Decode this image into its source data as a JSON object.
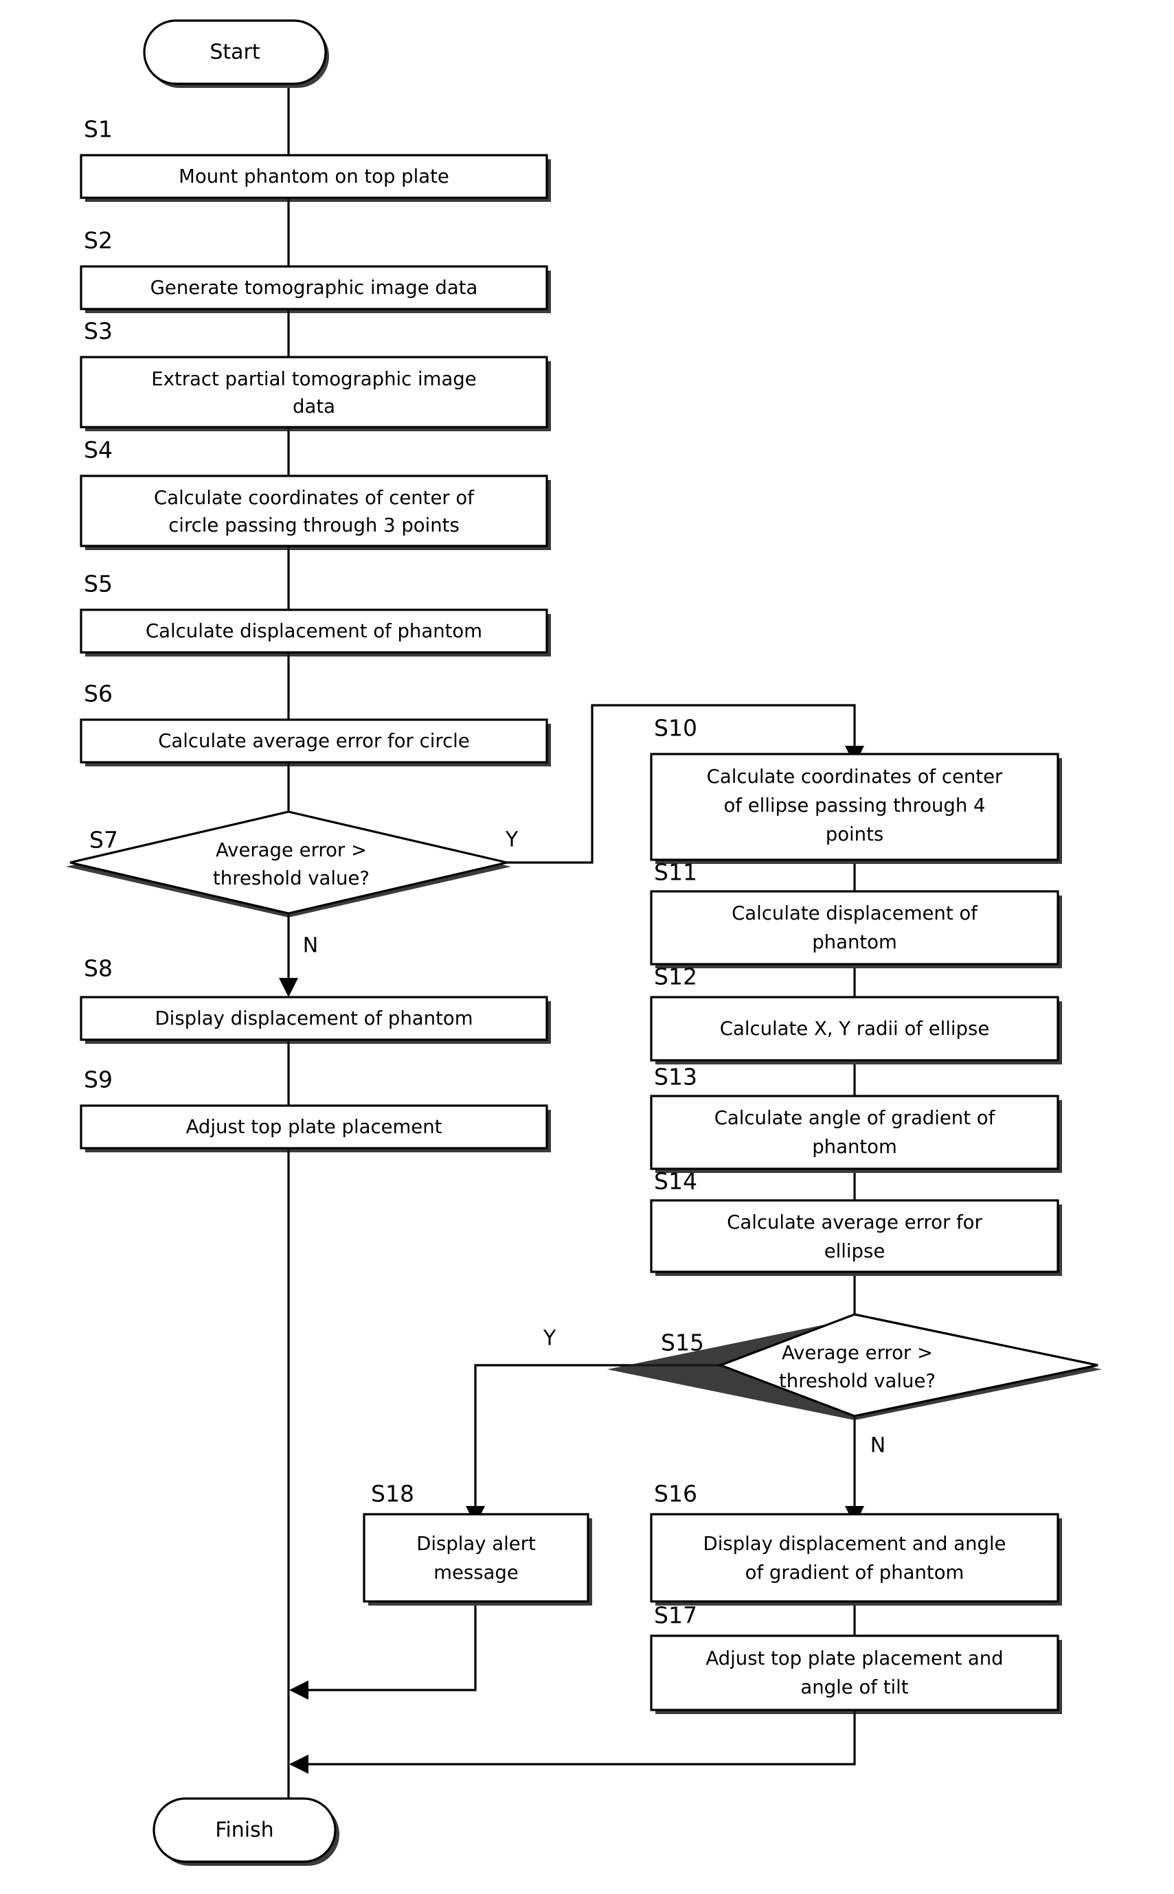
{
  "diagram": {
    "type": "flowchart",
    "title": "",
    "terminals": {
      "start": "Start",
      "finish": "Finish"
    },
    "branch_labels": {
      "s7_yes": "Y",
      "s7_no": "N",
      "s15_yes": "Y",
      "s15_no": "N"
    },
    "steps": [
      {
        "id": "S1",
        "label": "S1",
        "shape": "process",
        "lines": [
          "Mount phantom on top plate"
        ]
      },
      {
        "id": "S2",
        "label": "S2",
        "shape": "process",
        "lines": [
          "Generate tomographic image data"
        ]
      },
      {
        "id": "S3",
        "label": "S3",
        "shape": "process",
        "lines": [
          "Extract partial tomographic image",
          "data"
        ]
      },
      {
        "id": "S4",
        "label": "S4",
        "shape": "process",
        "lines": [
          "Calculate coordinates of center of",
          "circle passing through 3 points"
        ]
      },
      {
        "id": "S5",
        "label": "S5",
        "shape": "process",
        "lines": [
          "Calculate displacement of phantom"
        ]
      },
      {
        "id": "S6",
        "label": "S6",
        "shape": "process",
        "lines": [
          "Calculate average error for circle"
        ]
      },
      {
        "id": "S7",
        "label": "S7",
        "shape": "decision",
        "lines": [
          "Average error >",
          "threshold value?"
        ]
      },
      {
        "id": "S8",
        "label": "S8",
        "shape": "process",
        "lines": [
          "Display displacement of phantom"
        ]
      },
      {
        "id": "S9",
        "label": "S9",
        "shape": "process",
        "lines": [
          "Adjust top plate placement"
        ]
      },
      {
        "id": "S10",
        "label": "S10",
        "shape": "process",
        "lines": [
          "Calculate coordinates of center",
          "of ellipse passing through 4",
          "points"
        ]
      },
      {
        "id": "S11",
        "label": "S11",
        "shape": "process",
        "lines": [
          "Calculate displacement of",
          "phantom"
        ]
      },
      {
        "id": "S12",
        "label": "S12",
        "shape": "process",
        "lines": [
          "Calculate X, Y radii of ellipse"
        ]
      },
      {
        "id": "S13",
        "label": "S13",
        "shape": "process",
        "lines": [
          "Calculate angle of gradient of",
          "phantom"
        ]
      },
      {
        "id": "S14",
        "label": "S14",
        "shape": "process",
        "lines": [
          "Calculate average error for",
          "ellipse"
        ]
      },
      {
        "id": "S15",
        "label": "S15",
        "shape": "decision",
        "lines": [
          "Average error >",
          "threshold value?"
        ]
      },
      {
        "id": "S16",
        "label": "S16",
        "shape": "process",
        "lines": [
          "Display displacement and angle",
          "of gradient of phantom"
        ]
      },
      {
        "id": "S17",
        "label": "S17",
        "shape": "process",
        "lines": [
          "Adjust top plate placement and",
          "angle of tilt"
        ]
      },
      {
        "id": "S18",
        "label": "S18",
        "shape": "process",
        "lines": [
          "Display alert",
          "message"
        ]
      }
    ],
    "colors": {
      "stroke": "#000000",
      "fill": "#ffffff",
      "text": "#000000"
    }
  }
}
